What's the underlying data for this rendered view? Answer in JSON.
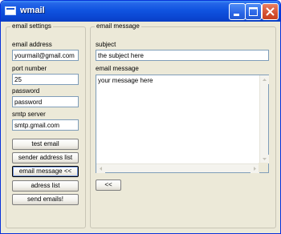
{
  "window": {
    "title": "wmail",
    "icon": "envelope-app-icon",
    "controls": [
      "minimize",
      "maximize",
      "close"
    ]
  },
  "settings": {
    "legend": "email settings",
    "email_label": "email address",
    "email_value": "yourmail@gmail.com",
    "port_label": "port number",
    "port_value": "25",
    "password_label": "password",
    "password_value": "password",
    "smtp_label": "smtp server",
    "smtp_value": "smtp.gmail.com",
    "buttons": {
      "test_email": "test email",
      "sender_list": "sender address list",
      "email_message": "email message <<",
      "adress_list": "adress list",
      "send_emails": "send emails!"
    }
  },
  "message": {
    "legend": "email message",
    "subject_label": "subject",
    "subject_value": "the subject here",
    "body_label": "email message",
    "body_value": "your message here",
    "collapse_button": "<<"
  },
  "colors": {
    "titlebar": "#0b48d4",
    "window_face": "#ece9d8",
    "input_border": "#7f9db9"
  }
}
